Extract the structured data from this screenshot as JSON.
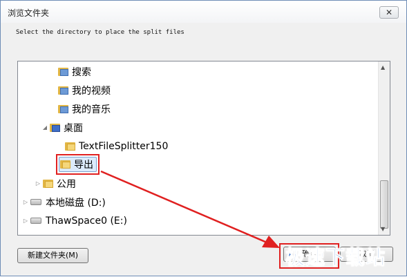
{
  "window": {
    "title": "浏览文件夹",
    "close_glyph": "✕",
    "instruction": "Select the directory to place the split files"
  },
  "tree": {
    "items": [
      {
        "label": "搜索",
        "icon": "search-folder-icon"
      },
      {
        "label": "我的视频",
        "icon": "video-folder-icon"
      },
      {
        "label": "我的音乐",
        "icon": "music-folder-icon"
      },
      {
        "label": "桌面",
        "icon": "desktop-icon",
        "expander": "◢"
      },
      {
        "label": "TextFileSplitter150",
        "icon": "folder-icon"
      },
      {
        "label": "导出",
        "icon": "folder-icon",
        "selected": true
      },
      {
        "label": "公用",
        "icon": "folder-icon",
        "expander": "▷"
      },
      {
        "label": "本地磁盘 (D:)",
        "icon": "drive-icon",
        "expander": "▷"
      },
      {
        "label": "ThawSpace0 (E:)",
        "icon": "drive-icon",
        "expander": "▷"
      }
    ]
  },
  "scrollbar": {
    "up": "▲",
    "down": "▼"
  },
  "buttons": {
    "new_folder": "新建文件夹(M)",
    "ok": "确定",
    "cancel": "取消"
  },
  "watermark": "极速下载站",
  "colors": {
    "highlight": "#e02020",
    "selection": "#dcebfc",
    "watermark": "#1e63c4"
  }
}
